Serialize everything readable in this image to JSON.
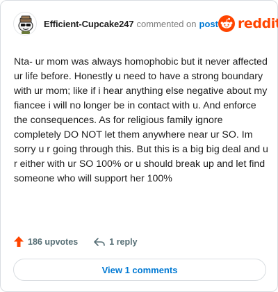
{
  "header": {
    "username": "Efficient-Cupcake247",
    "action_text": "commented on",
    "post_link": "post",
    "brand": "reddit"
  },
  "comment": {
    "body": "Nta- ur mom was always homophobic but it never affected ur life before. Honestly u need to have a strong boundary with ur mom; like if i hear anything else negative about my fiancee i will no longer be in contact with u. And enforce the consequences. As for religious family ignore completely DO NOT let them anywhere near ur SO. Im sorry u r going through this. But this is a big big deal and u r either with ur SO 100% or u should break up and let find someone who will support her 100%"
  },
  "actions": {
    "upvotes": "186 upvotes",
    "reply": "1 reply"
  },
  "view_comments": "View 1 comments",
  "colors": {
    "brand": "#ff4500",
    "link": "#0079d3"
  }
}
